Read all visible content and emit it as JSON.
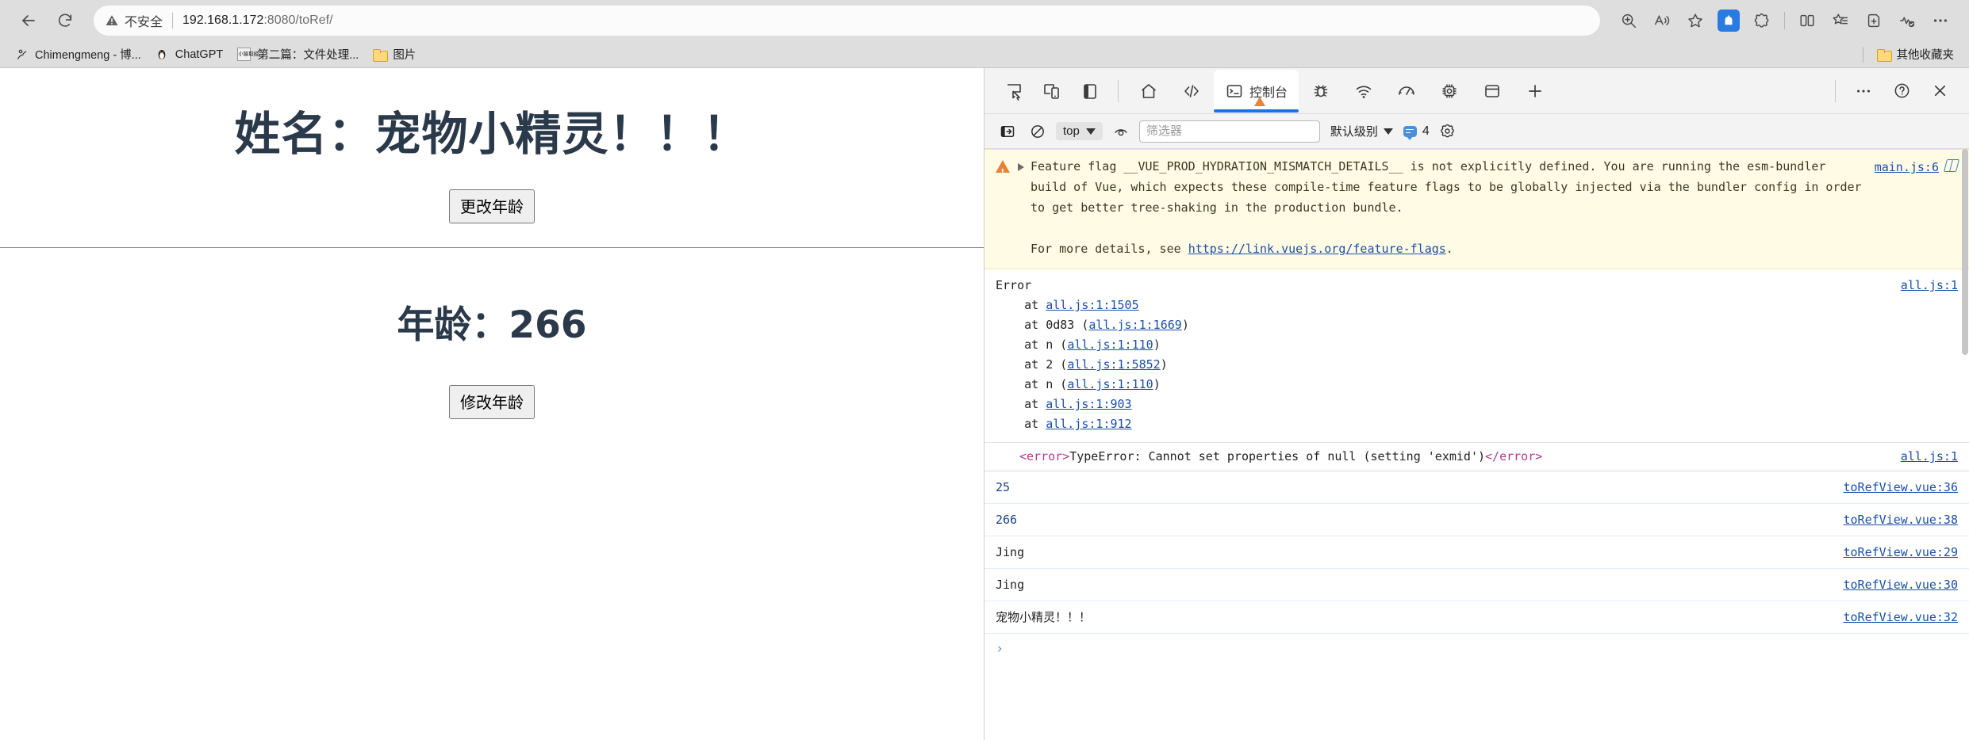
{
  "browser": {
    "back_label": "Back",
    "reload_label": "Reload",
    "security_label": "不安全",
    "url_host": "192.168.1.172",
    "url_rest": ":8080/toRef/",
    "zoom_label": "Zoom",
    "read_aloud_label": "Read aloud",
    "favorite_label": "Add to favorites",
    "collections_label": "Collections",
    "split_screen_label": "Split screen",
    "favorites_list_label": "Favorites",
    "add_tab_label": "Add tab",
    "browser_essentials_label": "Browser essentials",
    "settings_more_label": "Settings and more"
  },
  "bookmarks": {
    "items": [
      {
        "label": "Chimengmeng - 博...",
        "icon": "person-icon"
      },
      {
        "label": "ChatGPT",
        "icon": "penguin-icon"
      },
      {
        "label": "第二篇：文件处理...",
        "icon": "小猿取经"
      },
      {
        "label": "图片",
        "icon": "folder-icon"
      }
    ],
    "other_favorites": {
      "label": "其他收藏夹",
      "icon": "folder-icon"
    }
  },
  "page": {
    "name_heading": "姓名：宠物小精灵！！！",
    "change_age_button": "更改年龄",
    "age_heading": "年龄：266",
    "modify_age_button": "修改年龄"
  },
  "devtools": {
    "toolbar_icons": [
      "inspect-element-icon",
      "device-toolbar-icon",
      "dock-side-icon"
    ],
    "tabs": [
      {
        "label": "",
        "icon": "home-icon",
        "active": false
      },
      {
        "label": "",
        "icon": "elements-icon",
        "active": false
      },
      {
        "label": "控制台",
        "icon": "console-icon",
        "active": true
      },
      {
        "label": "",
        "icon": "bug-icon",
        "active": false
      },
      {
        "label": "",
        "icon": "network-icon",
        "active": false
      },
      {
        "label": "",
        "icon": "performance-icon",
        "active": false
      },
      {
        "label": "",
        "icon": "memory-icon",
        "active": false
      },
      {
        "label": "",
        "icon": "application-icon",
        "active": false
      },
      {
        "label": "",
        "icon": "plus-icon",
        "active": false
      }
    ],
    "more_tools_label": "更多工具",
    "help_label": "帮助",
    "close_label": "关闭",
    "filterbar": {
      "sidebar_toggle": "console-sidebar-icon",
      "clear_console": "clear-console-icon",
      "context": "top",
      "eye_icon": "live-expression-icon",
      "filter_placeholder": "筛选器",
      "filter_value": "",
      "level": "默认级别",
      "message_count": "4",
      "settings": "gear-icon"
    },
    "console": {
      "warning": {
        "text_part1": "Feature flag __VUE_PROD_HYDRATION_MISMATCH_DETAILS__ is not explicitly defined. You are running the esm-bundler build of Vue, which expects these compile-time feature flags to be globally injected via the bundler config in order to get better tree-shaking in the production bundle.",
        "text_part2_pre": "For more details, see ",
        "text_part2_link": "https://link.vuejs.org/feature-flags",
        "text_part2_post": ".",
        "source": "main.js:6"
      },
      "error": {
        "title": "Error",
        "source": "all.js:1",
        "stack": [
          {
            "prefix": "    at ",
            "fn": "",
            "link": "all.js:1:1505",
            "paren": false
          },
          {
            "prefix": "    at ",
            "fn": "0d83 ",
            "link": "all.js:1:1669",
            "paren": true
          },
          {
            "prefix": "    at ",
            "fn": "n ",
            "link": "all.js:1:110",
            "paren": true
          },
          {
            "prefix": "    at ",
            "fn": "2 ",
            "link": "all.js:1:5852",
            "paren": true
          },
          {
            "prefix": "    at ",
            "fn": "n ",
            "link": "all.js:1:110",
            "paren": true
          },
          {
            "prefix": "    at ",
            "fn": "",
            "link": "all.js:1:903",
            "paren": false
          },
          {
            "prefix": "    at ",
            "fn": "",
            "link": "all.js:1:912",
            "paren": false
          }
        ]
      },
      "typeerror": {
        "open_tag": "<error>",
        "body": "TypeError: Cannot set properties of null (setting 'exmid')",
        "close_tag": "</error>",
        "source": "all.js:1"
      },
      "logs": [
        {
          "text": "25",
          "kind": "num",
          "source": "toRefView.vue:36"
        },
        {
          "text": "266",
          "kind": "num",
          "source": "toRefView.vue:38"
        },
        {
          "text": "Jing",
          "kind": "str",
          "source": "toRefView.vue:29"
        },
        {
          "text": "Jing",
          "kind": "str",
          "source": "toRefView.vue:30"
        },
        {
          "text": "宠物小精灵！！！",
          "kind": "cn",
          "source": "toRefView.vue:32"
        }
      ],
      "prompt_symbol": "›"
    }
  }
}
